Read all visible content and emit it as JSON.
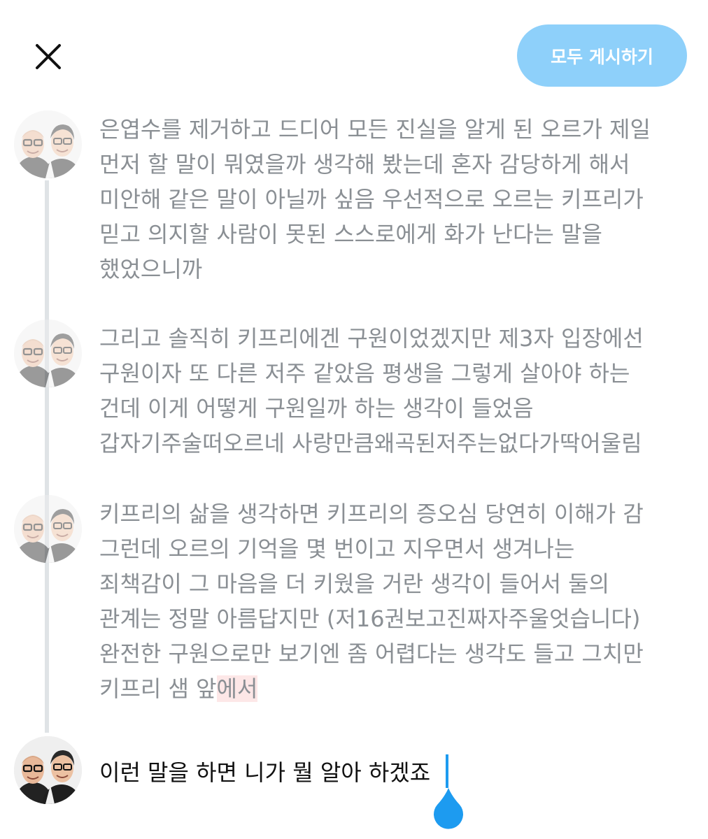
{
  "header": {
    "post_all_label": "모두 게시하기"
  },
  "icons": {
    "close": "close-icon",
    "avatar": "avatar-photo-two-men",
    "caret_handle": "text-selection-handle-icon"
  },
  "colors": {
    "accent": "#1d9bf0",
    "button_disabled": "#8ed0fa",
    "muted_text": "#8a8f94",
    "highlight": "#fde7e7"
  },
  "thread": {
    "tweets": [
      {
        "lines": [
          "은엽수를 제거하고 드디어 모든 진실을 알게 된 오르가 제일",
          "먼저 할 말이 뭐였을까 생각해 봤는데 혼자 감당하게 해서",
          "미안해 같은 말이 아닐까 싶음 우선적으로 오르는 키프리가",
          "믿고 의지할 사람이 못된 스스로에게 화가 난다는 말을",
          "했었으니까"
        ]
      },
      {
        "lines": [
          "그리고 솔직히 키프리에겐 구원이었겠지만 제3자 입장에선",
          "구원이자 또 다른 저주 같았음 평생을 그렇게 살아야 하는",
          "건데 이게 어떻게 구원일까 하는 생각이 들었음",
          "갑자기주술떠오르네 사랑만큼왜곡된저주는없다가딱어울림"
        ]
      },
      {
        "lines": [
          "키프리의 삶을 생각하면 키프리의 증오심 당연히 이해가 감",
          "그런데 오르의 기억을 몇 번이고 지우면서 생겨나는",
          "죄책감이 그 마음을 더 키웠을 거란 생각이 들어서 둘의",
          "관계는 정말 아름답지만 (저16권보고진짜자주울엇습니다)",
          "완전한 구원으로만 보기엔 좀 어렵다는 생각도 들고 그치만"
        ],
        "last_line_prefix": "키프리 샘 앞",
        "last_line_highlight": "에서"
      }
    ]
  },
  "compose": {
    "text": "이런 말을 하면 니가 뭘 알아 하겠죠"
  }
}
